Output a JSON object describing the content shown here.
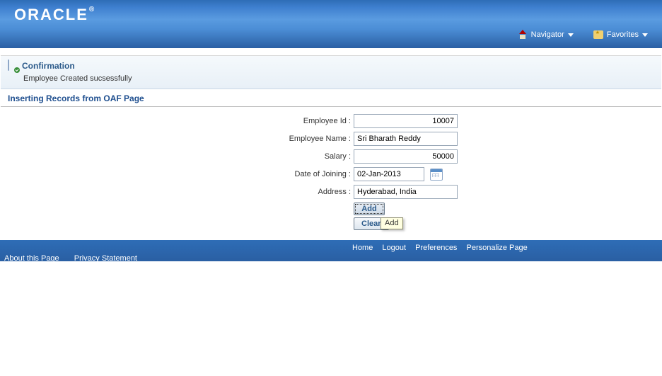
{
  "header": {
    "logo_text": "ORACLE",
    "logo_reg": "®",
    "navigator_label": "Navigator",
    "favorites_label": "Favorites"
  },
  "confirmation": {
    "title": "Confirmation",
    "message": "Employee Created sucsessfully"
  },
  "section": {
    "title": "Inserting Records from OAF Page"
  },
  "form": {
    "employee_id": {
      "label": "Employee Id :",
      "value": "10007"
    },
    "employee_name": {
      "label": "Employee Name :",
      "value": "Sri Bharath Reddy"
    },
    "salary": {
      "label": "Salary :",
      "value": "50000"
    },
    "doj": {
      "label": "Date of Joining :",
      "value": "02-Jan-2013"
    },
    "address": {
      "label": "Address :",
      "value": "Hyderabad, India"
    },
    "add_button": "Add",
    "clear_button": "Clear",
    "tooltip": "Add"
  },
  "footer": {
    "home": "Home",
    "logout": "Logout",
    "preferences": "Preferences",
    "personalize": "Personalize Page",
    "about": "About this Page",
    "privacy": "Privacy Statement"
  }
}
